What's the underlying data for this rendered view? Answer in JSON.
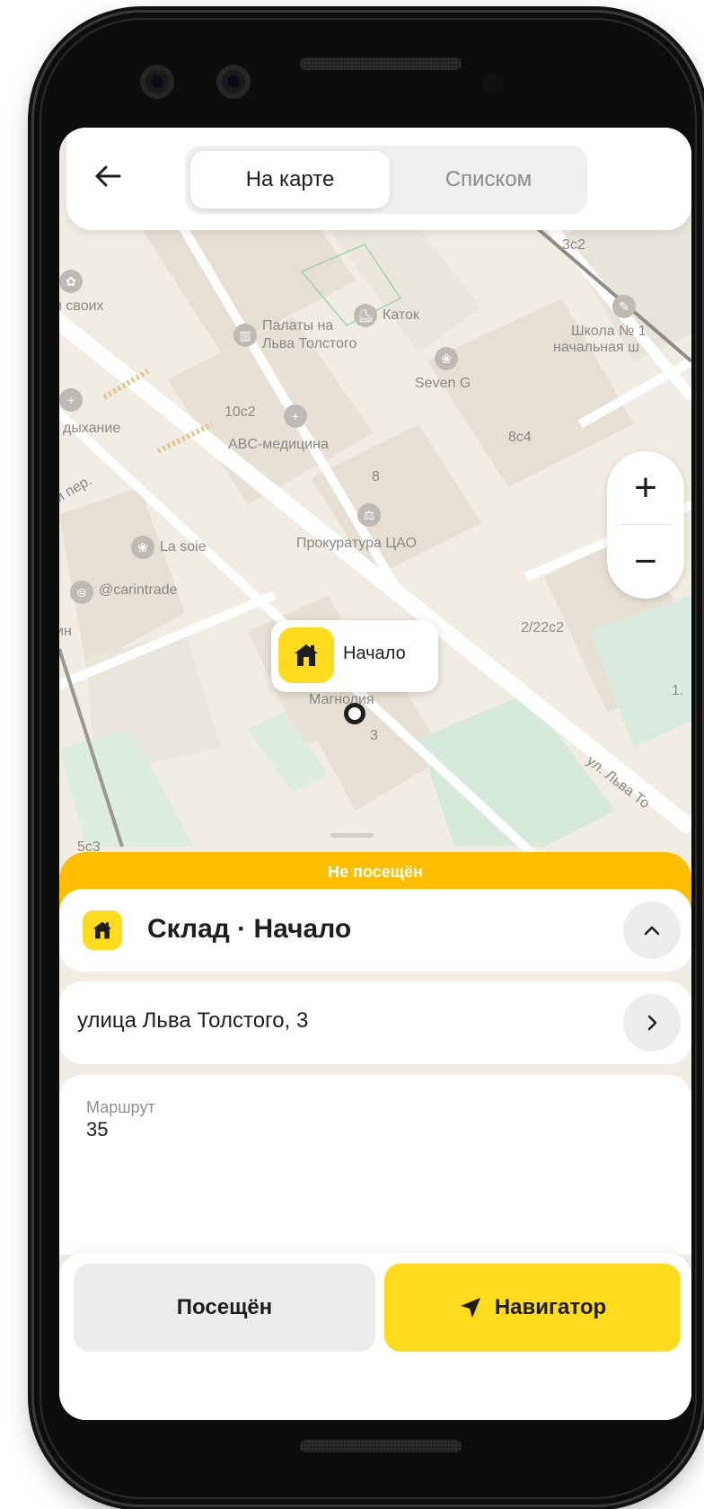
{
  "header": {
    "back_icon": "arrow-left-icon",
    "tab_map": "На карте",
    "tab_list": "Списком",
    "active_tab": "На карте"
  },
  "map": {
    "labels": {
      "katok": "Каток",
      "palaty": "Палаты на",
      "palaty2": "Льва Толстого",
      "school": "Школа № 1",
      "school2": "начальная ш",
      "seven": "Seven G",
      "b10c2": "10с2",
      "abc": "ABC-медицина",
      "b8c4": "8с4",
      "b8": "8",
      "prokuratura": "Прокуратура ЦАО",
      "lasoie": "La soie",
      "carintrade": "@carintrade",
      "b222c2": "2/22с2",
      "magnolia": "Магнолия",
      "b3": "3",
      "street": "ул. Льва То",
      "b3c2": "3с2",
      "svoih": "и своих",
      "dyhanie": "дыхание",
      "per": "й пер.",
      "b5c3": "5с3",
      "n": "ин",
      "b1": "1."
    },
    "zoom_in": "+",
    "zoom_out": "−",
    "pin_label": "Начало",
    "pin_icon": "house-icon"
  },
  "sheet": {
    "status": "Не посещён",
    "status_color": "#ffbf00",
    "title": "Склад · Начало",
    "address": "улица Льва Толстого, 3",
    "route_label": "Маршрут",
    "route_value": "35"
  },
  "actions": {
    "visited": "Посещён",
    "navigator": "Навигатор"
  },
  "colors": {
    "accent": "#ffdb1e",
    "status": "#ffbf00"
  }
}
